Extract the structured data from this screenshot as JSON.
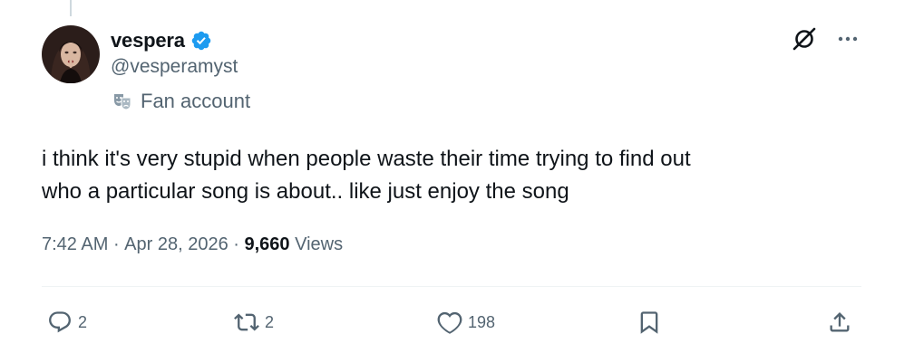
{
  "author": {
    "display_name": "vespera",
    "handle": "@vesperamyst",
    "label": "Fan account",
    "verified": true,
    "verified_color": "#1d9bf0"
  },
  "tweet": {
    "text_line_1": "i think it's very stupid when people waste their time trying to find out",
    "text_line_2": "who a particular song is about.. like just enjoy the song",
    "time": "7:42 AM",
    "separator": " · ",
    "date": "Apr 28, 2026",
    "views_count": "9,660",
    "views_label": "Views"
  },
  "actions": {
    "reply_count": "2",
    "repost_count": "2",
    "like_count": "198"
  },
  "icons": {
    "top": [
      "grok-icon",
      "more-icon"
    ],
    "bar": [
      "reply-icon",
      "repost-icon",
      "like-icon",
      "bookmark-icon",
      "share-icon"
    ]
  },
  "colors": {
    "text": "#0f1419",
    "secondary": "#536471",
    "divider": "#eff3f4"
  }
}
